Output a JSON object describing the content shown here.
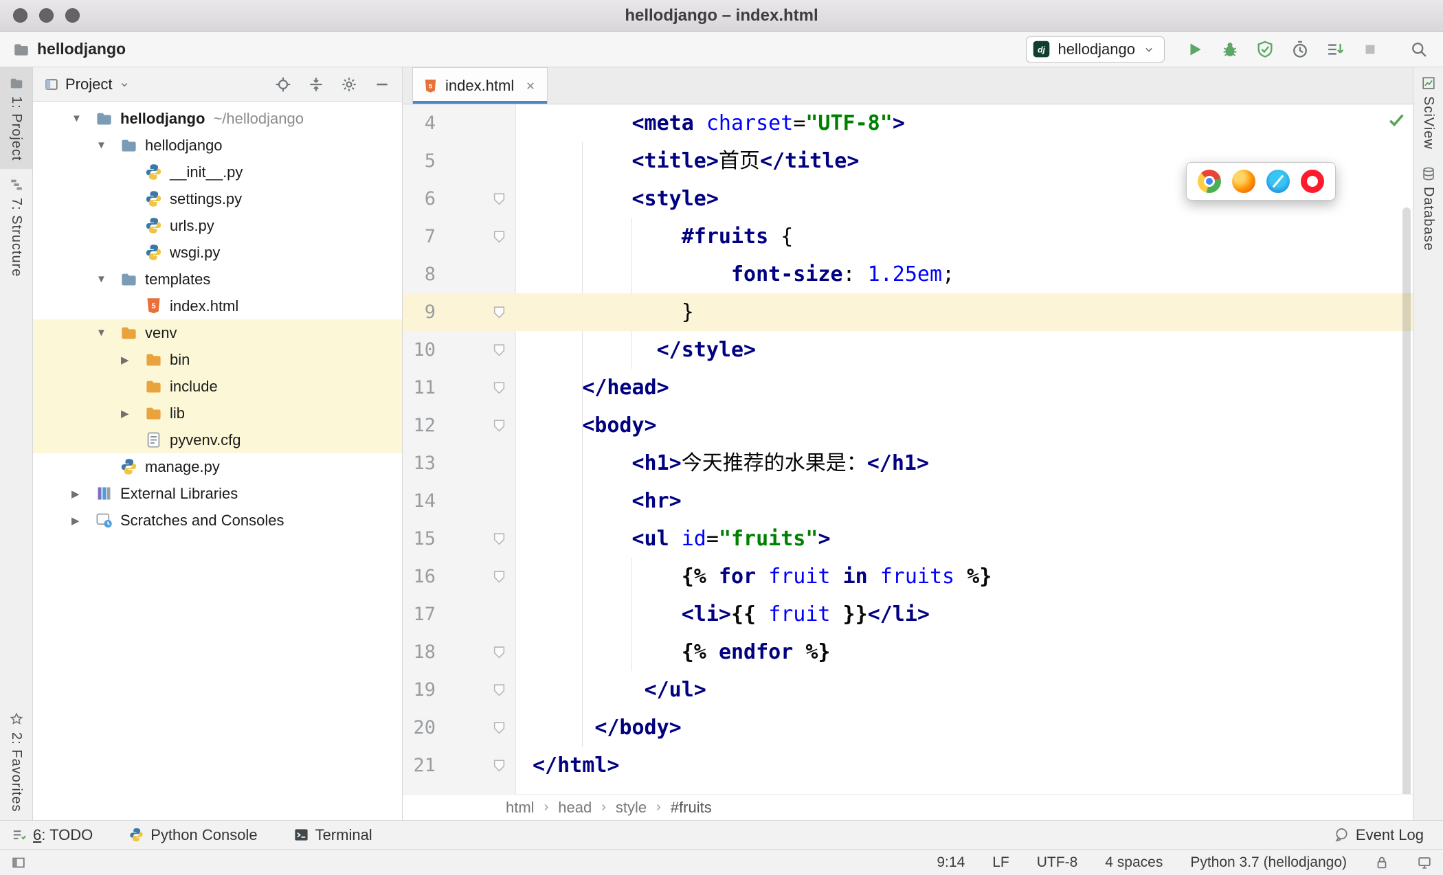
{
  "window": {
    "title": "hellodjango – index.html"
  },
  "toolbar": {
    "project": "hellodjango",
    "run_config": {
      "name": "hellodjango"
    },
    "actions": [
      "run",
      "debug",
      "run-with-coverage",
      "profile",
      "concurrency-diagram",
      "stop",
      "search-everywhere"
    ]
  },
  "stripes": {
    "project": "1: Project",
    "structure": "7: Structure",
    "favorites": "2: Favorites",
    "sciview": "SciView",
    "database": "Database"
  },
  "project_panel": {
    "title": "Project",
    "tree": [
      {
        "label": "hellodjango",
        "hint": "~/hellodjango",
        "depth": 0,
        "icon": "folder",
        "arrow": "open",
        "bold": true
      },
      {
        "label": "hellodjango",
        "depth": 1,
        "icon": "folder",
        "arrow": "open"
      },
      {
        "label": "__init__.py",
        "depth": 2,
        "icon": "python"
      },
      {
        "label": "settings.py",
        "depth": 2,
        "icon": "python"
      },
      {
        "label": "urls.py",
        "depth": 2,
        "icon": "python"
      },
      {
        "label": "wsgi.py",
        "depth": 2,
        "icon": "python"
      },
      {
        "label": "templates",
        "depth": 1,
        "icon": "folder",
        "arrow": "open"
      },
      {
        "label": "index.html",
        "depth": 2,
        "icon": "html"
      },
      {
        "label": "venv",
        "depth": 1,
        "icon": "folderx",
        "arrow": "open",
        "hl": true
      },
      {
        "label": "bin",
        "depth": 2,
        "icon": "folderx",
        "arrow": "closed",
        "hl": true
      },
      {
        "label": "include",
        "depth": 2,
        "icon": "folderx",
        "hl": true
      },
      {
        "label": "lib",
        "depth": 2,
        "icon": "folderx",
        "arrow": "closed",
        "hl": true
      },
      {
        "label": "pyvenv.cfg",
        "depth": 2,
        "icon": "cfg",
        "hl": true
      },
      {
        "label": "manage.py",
        "depth": 1,
        "icon": "python"
      },
      {
        "label": "External Libraries",
        "depth": 0,
        "icon": "libs",
        "arrow": "closed"
      },
      {
        "label": "Scratches and Consoles",
        "depth": 0,
        "icon": "scratch",
        "arrow": "closed"
      }
    ]
  },
  "editor": {
    "tab": {
      "label": "index.html"
    },
    "browser_icons": [
      "chrome",
      "firefox",
      "safari",
      "opera"
    ],
    "breadcrumb_separator": "›",
    "breadcrumbs": [
      "html",
      "head",
      "style",
      "#fruits"
    ],
    "lines": [
      {
        "num": 4,
        "indent": 8,
        "marker": false,
        "tokens": [
          [
            "<meta ",
            "tag"
          ],
          [
            "charset",
            "attr"
          ],
          [
            "=",
            "text"
          ],
          [
            "\"UTF-8\"",
            "val"
          ],
          [
            ">",
            "tag"
          ]
        ]
      },
      {
        "num": 5,
        "indent": 8,
        "marker": false,
        "tokens": [
          [
            "<title>",
            "tag"
          ],
          [
            "首页",
            "text"
          ],
          [
            "</title>",
            "tag"
          ]
        ]
      },
      {
        "num": 6,
        "indent": 8,
        "marker": true,
        "tokens": [
          [
            "<style>",
            "tag"
          ]
        ]
      },
      {
        "num": 7,
        "indent": 12,
        "marker": true,
        "tokens": [
          [
            "#fruits",
            "sel"
          ],
          [
            " {",
            "text"
          ]
        ]
      },
      {
        "num": 8,
        "indent": 16,
        "marker": false,
        "tokens": [
          [
            "font-size",
            "prop"
          ],
          [
            ": ",
            "text"
          ],
          [
            "1.25em",
            "num"
          ],
          [
            ";",
            "text"
          ]
        ]
      },
      {
        "num": 9,
        "indent": 12,
        "marker": true,
        "current": true,
        "tokens": [
          [
            "}",
            "text"
          ]
        ]
      },
      {
        "num": 10,
        "indent": 10,
        "marker": true,
        "tokens": [
          [
            "</style>",
            "tag"
          ]
        ]
      },
      {
        "num": 11,
        "indent": 4,
        "marker": true,
        "tokens": [
          [
            "</head>",
            "tag"
          ]
        ]
      },
      {
        "num": 12,
        "indent": 4,
        "marker": true,
        "tokens": [
          [
            "<body>",
            "tag"
          ]
        ]
      },
      {
        "num": 13,
        "indent": 8,
        "marker": false,
        "tokens": [
          [
            "<h1>",
            "tag"
          ],
          [
            "今天推荐的水果是：",
            "text"
          ],
          [
            "</h1>",
            "tag"
          ]
        ]
      },
      {
        "num": 14,
        "indent": 8,
        "marker": false,
        "tokens": [
          [
            "<hr>",
            "tag"
          ]
        ]
      },
      {
        "num": 15,
        "indent": 8,
        "marker": true,
        "tokens": [
          [
            "<ul ",
            "tag"
          ],
          [
            "id",
            "attr"
          ],
          [
            "=",
            "text"
          ],
          [
            "\"fruits\"",
            "val"
          ],
          [
            ">",
            "tag"
          ]
        ]
      },
      {
        "num": 16,
        "indent": 12,
        "marker": true,
        "tokens": [
          [
            "{% ",
            "brace"
          ],
          [
            "for",
            "kw"
          ],
          [
            " ",
            "text"
          ],
          [
            "fruit",
            "var"
          ],
          [
            " ",
            "text"
          ],
          [
            "in",
            "kw"
          ],
          [
            " ",
            "text"
          ],
          [
            "fruits",
            "var"
          ],
          [
            " %}",
            "brace"
          ]
        ]
      },
      {
        "num": 17,
        "indent": 12,
        "marker": false,
        "tokens": [
          [
            "<li>",
            "tag"
          ],
          [
            "{{ ",
            "brace"
          ],
          [
            "fruit",
            "var"
          ],
          [
            " }}",
            "brace"
          ],
          [
            "</li>",
            "tag"
          ]
        ]
      },
      {
        "num": 18,
        "indent": 12,
        "marker": true,
        "tokens": [
          [
            "{% ",
            "brace"
          ],
          [
            "endfor",
            "kw"
          ],
          [
            " %}",
            "brace"
          ]
        ]
      },
      {
        "num": 19,
        "indent": 9,
        "marker": true,
        "tokens": [
          [
            "</ul>",
            "tag"
          ]
        ]
      },
      {
        "num": 20,
        "indent": 5,
        "marker": true,
        "tokens": [
          [
            "</body>",
            "tag"
          ]
        ]
      },
      {
        "num": 21,
        "indent": 0,
        "marker": true,
        "tokens": [
          [
            "</html>",
            "tag"
          ]
        ]
      }
    ]
  },
  "tool_bar": {
    "todo_num": "6",
    "todo_label": ": TODO",
    "python_console": "Python Console",
    "terminal": "Terminal",
    "event_log": "Event Log"
  },
  "status_bar": {
    "caret_position": "9:14",
    "line_separator": "LF",
    "encoding": "UTF-8",
    "indent_style": "4 spaces",
    "interpreter": "Python 3.7 (hellodjango)"
  },
  "colors": {
    "tab_accent": "#4e86c8",
    "run_green": "#5ca765",
    "current_line": "#fbf4d7",
    "excluded_highlight": "#fcf8d7",
    "excluded_folder": "#e8a33d"
  }
}
